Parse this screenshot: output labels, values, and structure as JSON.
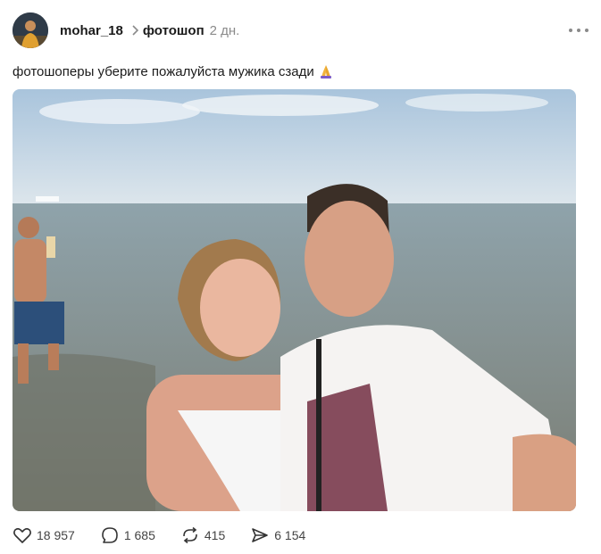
{
  "post": {
    "author": "mohar_18",
    "community": "фотошоп",
    "time": "2 дн.",
    "text": "фотошоперы уберите пожалуйста мужика сзади",
    "emoji_icon": "praying-hands-icon"
  },
  "actions": {
    "likes": "18 957",
    "comments": "1 685",
    "reposts": "415",
    "shares": "6 154"
  },
  "colors": {
    "sky": "#c9dbe9",
    "sea": "#8f9c9a",
    "author_text": "#1b1b1b",
    "muted": "#8a8a8a"
  }
}
